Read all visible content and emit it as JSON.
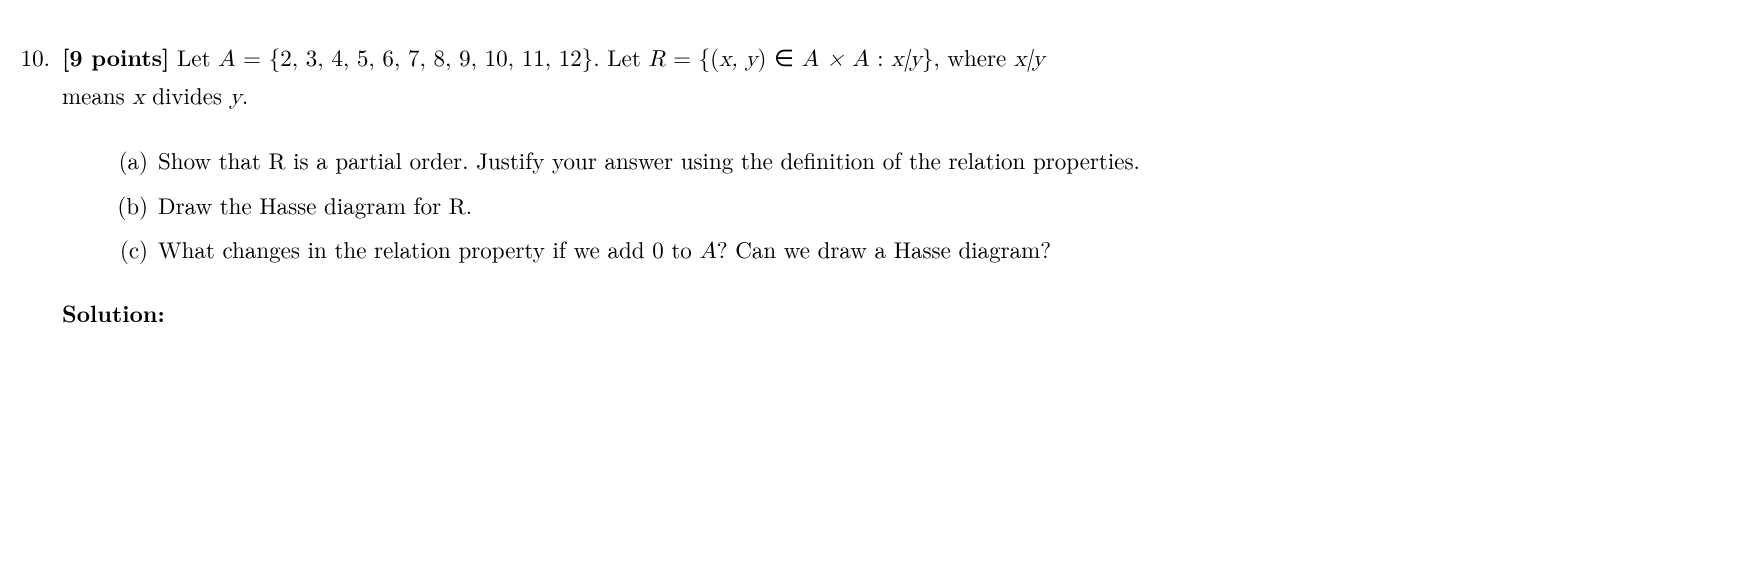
{
  "problem": {
    "number": "10.",
    "points_label": "[9 points]",
    "statement_prefix": " Let ",
    "set_A_lhs": "A",
    "equals": " = ",
    "set_A_value": "{2, 3, 4, 5, 6, 7, 8, 9, 10, 11, 12}",
    "period_space": ".  Let ",
    "set_R_lhs": "R",
    "set_R_value_open": "{(",
    "xy_pair": "x, y",
    "set_R_value_mid": ") ∈ ",
    "AxA": "A × A",
    "colon": " : ",
    "xdivy": "x|y",
    "set_R_value_close": "}",
    "statement_suffix_1": ", where ",
    "xdivy2": "x|y",
    "statement_line2_prefix": "means ",
    "x_var": "x",
    "divides": " divides ",
    "y_var": "y",
    "statement_end": "."
  },
  "subparts": {
    "a": {
      "label": "(a)",
      "text": "Show that R is a partial order.  Justify your answer using the definition of the relation properties."
    },
    "b": {
      "label": "(b)",
      "text": "Draw the Hasse diagram for R."
    },
    "c": {
      "label": "(c)",
      "text_1": "What changes in the relation property if we add 0 to ",
      "A_var": "A",
      "text_2": "?  Can we draw a Hasse diagram?"
    }
  },
  "solution_label": "Solution:"
}
